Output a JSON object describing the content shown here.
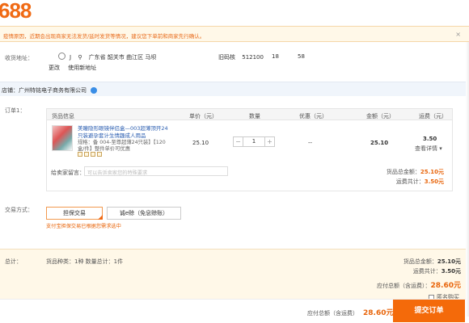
{
  "logo": "688",
  "notice": {
    "text": "疫情原因，近期会出现商家无法发货/延时发货等情况，建议您下单前和商家先行确认。",
    "close": "×"
  },
  "address": {
    "label": "收货地址：",
    "name": "J",
    "region": "广东省 韶关市 曲江区 马坝",
    "tag": "旧码核",
    "zip": "512100",
    "phone1": "18",
    "phone2": "58",
    "change": "更改",
    "use_new": "使用新地址"
  },
  "shop": {
    "label": "店铺：广州特铭电子商务有限公司"
  },
  "order": {
    "label": "订单1：",
    "headers": {
      "info": "货品信息",
      "unit_price": "单价（元）",
      "quantity": "数量",
      "discount": "优惠（元）",
      "amount": "金额（元）",
      "shipping": "运费（元）"
    },
    "item": {
      "name": "美瞳隐形眼镜伴侣盒—003超薄顶开24只装避孕套计生情趣成人用品",
      "spec": "规格：备 004-至尊超薄24只装】【120盒/件】整件单价可优惠",
      "unit_price": "25.10",
      "quantity": "1",
      "discount": "--",
      "amount": "25.10",
      "shipping": "3.50",
      "shipping_detail": "查看详情 ▾"
    },
    "memo_label": "给卖家留言：",
    "memo_placeholder": "可以告诉卖家您的特殊要求",
    "subtotal_label": "货品总金额：",
    "subtotal": "25.10元",
    "shipping_label": "运费共计：",
    "shipping_total": "3.50元"
  },
  "payment": {
    "label": "交易方式：",
    "option1": "担保交易",
    "option2": "诚e赊（免息赊账）",
    "hint": "支付宝担保交易已根据您需求选中"
  },
  "summary": {
    "label": "总计：",
    "counts": "货品种类：1种  数量总计：1件",
    "goods_label": "货品总金额：",
    "goods": "25.10元",
    "ship_label": "运费共计：",
    "ship": "3.50元",
    "total_label": "应付总额（含运费）：",
    "total": "28.60元",
    "anonymous": "匿名购买"
  },
  "footer": {
    "total_label": "应付总额（含运费）",
    "total": "28.60元",
    "submit": "提交订单"
  }
}
